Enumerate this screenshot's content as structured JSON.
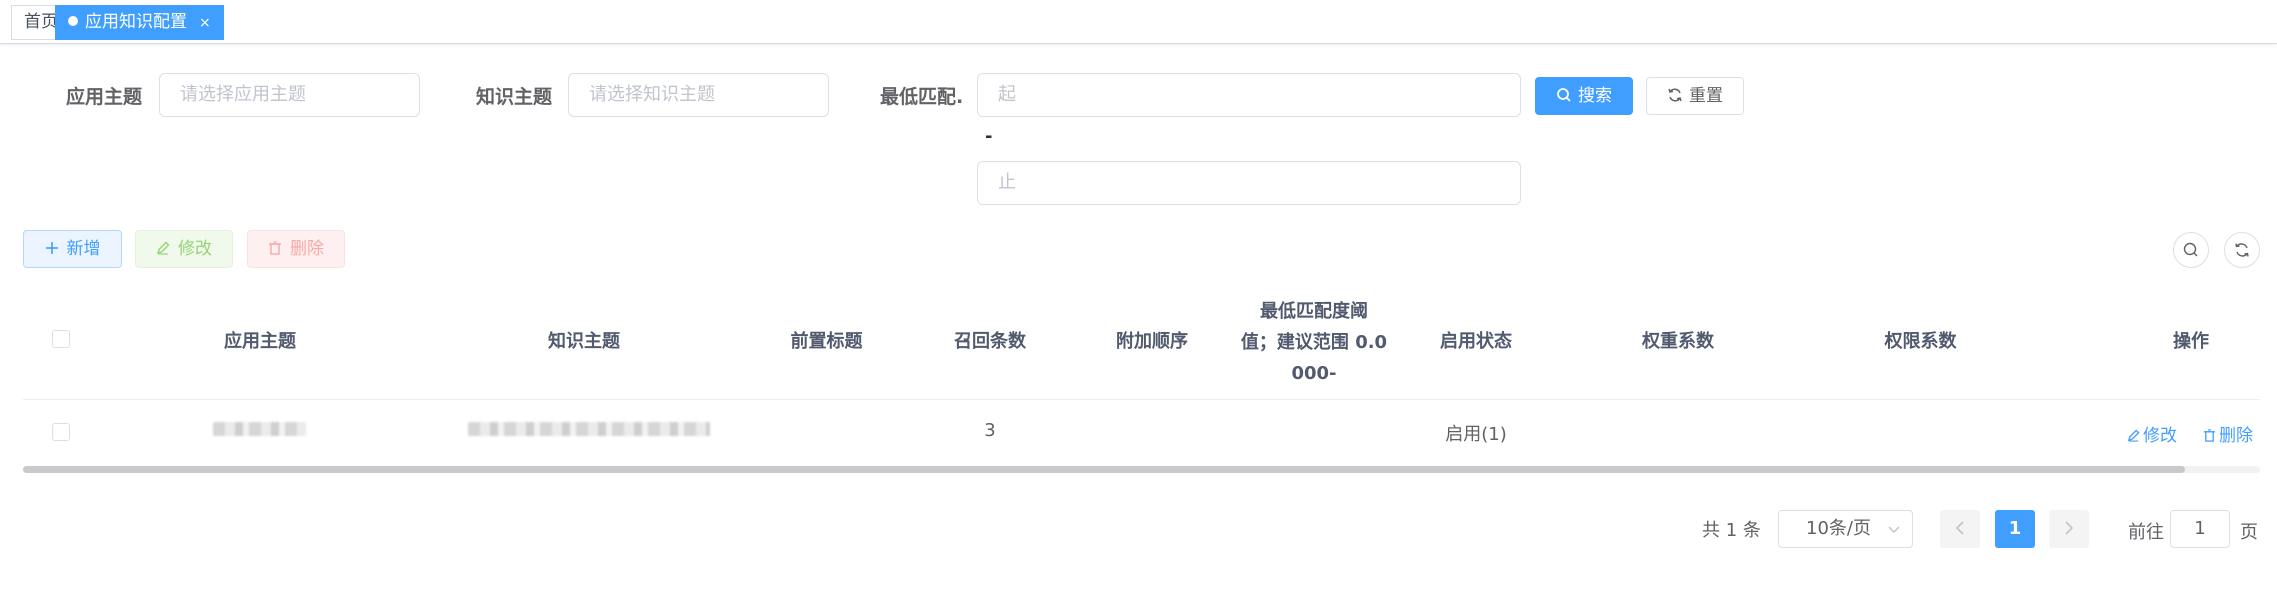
{
  "tags": {
    "home": "首页",
    "active": "应用知识配置",
    "active_close": "×"
  },
  "search": {
    "app_topic_label": "应用主题",
    "app_topic_placeholder": "请选择应用主题",
    "knowledge_topic_label": "知识主题",
    "knowledge_topic_placeholder": "请选择知识主题",
    "min_match_label": "最低匹配.",
    "range_start_placeholder": "起",
    "range_separator": "-",
    "range_end_placeholder": "止",
    "search_button": "搜索",
    "reset_button": "重置"
  },
  "toolbar": {
    "add": "新增",
    "edit": "修改",
    "delete": "删除"
  },
  "table": {
    "headers": {
      "app_topic": "应用主题",
      "knowledge_topic": "知识主题",
      "prefix_title": "前置标题",
      "recall_count": "召回条数",
      "append_order": "附加顺序",
      "min_match_line1": "最低匹配度阈",
      "min_match_line2": "值；建议范围 0.0",
      "min_match_line3": "000-",
      "status": "启用状态",
      "weight": "权重系数",
      "permission": "权限系数",
      "actions": "操作"
    },
    "rows": [
      {
        "recall_count": "3",
        "status": "启用(1)",
        "edit": "修改",
        "delete": "删除"
      }
    ]
  },
  "pagination": {
    "total": "共 1 条",
    "page_size": "10条/页",
    "current_page": "1",
    "goto_label": "前往",
    "goto_value": "1",
    "page_suffix": "页"
  },
  "colors": {
    "primary": "#409eff",
    "success_plain": "#95d475",
    "danger_plain": "#f9a7a7"
  }
}
